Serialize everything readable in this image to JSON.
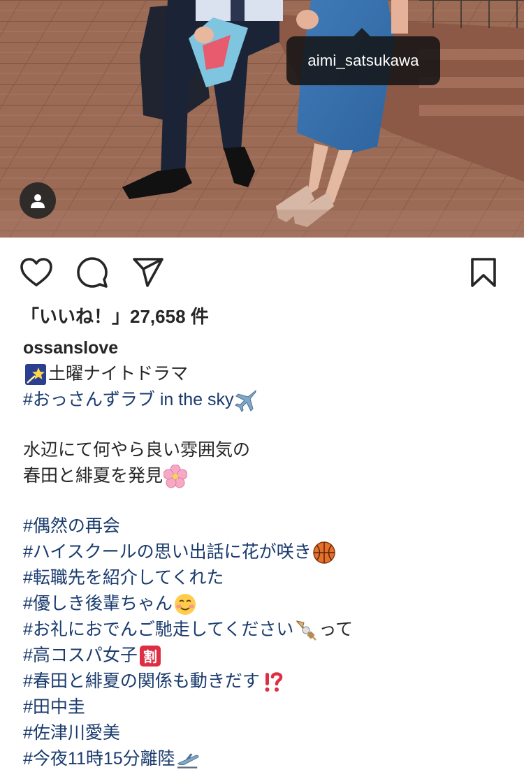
{
  "photo": {
    "tag_username": "aimi_satsukawa",
    "user_tag_icon": "person-icon"
  },
  "actions": {
    "like_icon": "heart-icon",
    "comment_icon": "comment-icon",
    "share_icon": "paper-plane-icon",
    "save_icon": "bookmark-icon"
  },
  "likes": {
    "text": "「いいね！」27,658 件"
  },
  "caption": {
    "username": "ossanslove",
    "line1": "土曜ナイトドラマ",
    "line2_tag": "#おっさんずラブ in the sky",
    "line3": "水辺にて何やら良い雰囲気の",
    "line4": "春田と緋夏を発見",
    "tags": {
      "t1": "#偶然の再会",
      "t2": "#ハイスクールの思い出話に花が咲き",
      "t3": "#転職先を紹介してくれた",
      "t4": "#優しき後輩ちゃん",
      "t5": "#お礼におでんご馳走してください",
      "t5_suffix": "って",
      "t6": "#高コスパ女子",
      "t7": "#春田と緋夏の関係も動きだす",
      "t8": "#田中圭",
      "t9": "#佐津川愛美",
      "t10": "#今夜11時15分離陸"
    },
    "emoji_names": [
      "shooting-star-emoji",
      "airplane-emoji",
      "cherry-blossom-emoji",
      "basketball-emoji",
      "smiling-face-emoji",
      "oden-emoji",
      "discount-kanji-emoji",
      "exclamation-question-emoji",
      "airplane-departure-emoji"
    ]
  },
  "colors": {
    "hashtag": "#1a3b6e",
    "text": "#262626",
    "tooltip_bg": "#141414"
  }
}
